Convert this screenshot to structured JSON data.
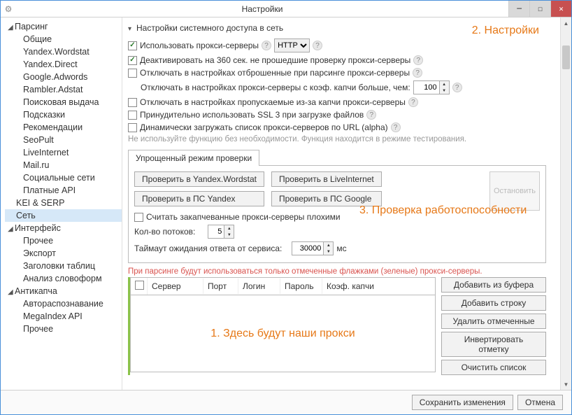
{
  "titlebar": {
    "title": "Настройки"
  },
  "sidebar": {
    "groups": [
      {
        "label": "Парсинг",
        "items": [
          "Общие",
          "Yandex.Wordstat",
          "Yandex.Direct",
          "Google.Adwords",
          "Rambler.Adstat",
          "Поисковая выдача",
          "Подсказки",
          "Рекомендации",
          "SeoPult",
          "LiveInternet",
          "Mail.ru",
          "Социальные сети",
          "Платные API"
        ]
      },
      {
        "label": "KEI & SERP",
        "items": []
      },
      {
        "label": "Сеть",
        "selected": true,
        "items": []
      },
      {
        "label": "Интерфейс",
        "items": [
          "Прочее",
          "Экспорт",
          "Заголовки таблиц",
          "Анализ словоформ"
        ]
      },
      {
        "label": "Антикапча",
        "items": [
          "Автораспознавание",
          "MegaIndex API",
          "Прочее"
        ]
      }
    ]
  },
  "section": {
    "title": "Настройки системного доступа в сеть"
  },
  "opts": {
    "use_proxy": "Использовать прокси-серверы",
    "proxy_type": "HTTP",
    "deactivate_360": "Деактивировать на 360 сек. не прошедшие проверку прокси-серверы",
    "disable_rejected": "Отключать в настройках отброшенные при парсинге прокси-серверы",
    "disable_captcha_coef": "Отключать в настройках прокси-серверы с коэф. капчи больше, чем:",
    "coef_value": "100",
    "disable_skipped_captcha": "Отключать в настройках пропускаемые из-за капчи прокси-серверы",
    "force_ssl3": "Принудительно использовать SSL 3 при загрузке файлов",
    "dynamic_load": "Динамически загружать список прокси-серверов по URL (alpha)",
    "note": "Не используйте функцию без необходимости. Функция находится в режиме тестирования."
  },
  "check": {
    "tab": "Упрощенный режим проверки",
    "btn_wordstat": "Проверить в Yandex.Wordstat",
    "btn_liveinternet": "Проверить в LiveInternet",
    "btn_ps_yandex": "Проверить в ПС Yandex",
    "btn_ps_google": "Проверить в ПС Google",
    "stop": "Остановить",
    "count_bad": "Считать закапчеванные прокси-серверы плохими",
    "threads_label": "Кол-во потоков:",
    "threads_value": "5",
    "timeout_label": "Таймаут ожидания ответа от сервиса:",
    "timeout_value": "30000",
    "timeout_unit": "мс"
  },
  "table": {
    "warn": "При парсинге будут использоваться только отмеченные флажками (зеленые) прокси-серверы.",
    "cols": {
      "server": "Сервер",
      "port": "Порт",
      "login": "Логин",
      "password": "Пароль",
      "coef": "Коэф. капчи"
    }
  },
  "sidebtns": {
    "add_buffer": "Добавить из буфера",
    "add_row": "Добавить строку",
    "del_marked": "Удалить отмеченные",
    "invert": "Инвертировать отметку",
    "clear": "Очистить список"
  },
  "bottom": {
    "save": "Сохранить изменения",
    "cancel": "Отмена"
  },
  "anno": {
    "a1": "1. Здесь будут наши прокси",
    "a2": "2. Настройки",
    "a3": "3. Проверка работоспособности"
  }
}
